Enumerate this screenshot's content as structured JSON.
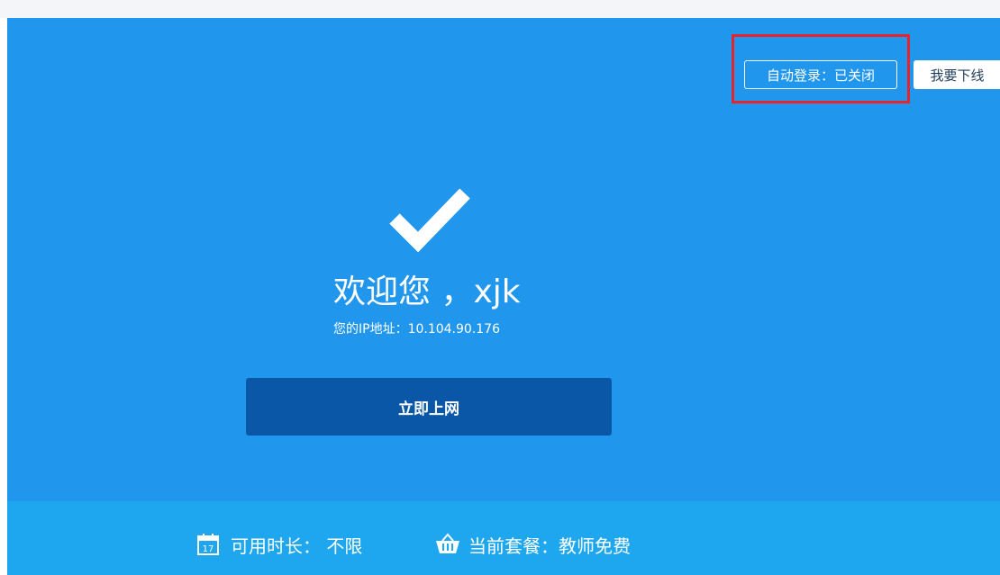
{
  "header": {
    "auto_login_label": "自动登录：已关闭",
    "logout_label": "我要下线"
  },
  "main": {
    "welcome_text": "欢迎您 ，xjk",
    "ip_text": "您的IP地址：10.104.90.176",
    "go_online_label": "立即上网"
  },
  "footer": {
    "duration_label": "可用时长：  不限",
    "calendar_day": "17",
    "package_label": "当前套餐：教师免费"
  },
  "icons": {
    "check": "check-icon",
    "calendar": "calendar-icon",
    "basket": "basket-icon"
  },
  "colors": {
    "main_background": "#2196ed",
    "footer_background": "#1ea7ee",
    "primary_button": "#0a57a8",
    "highlight": "#e5252b"
  }
}
